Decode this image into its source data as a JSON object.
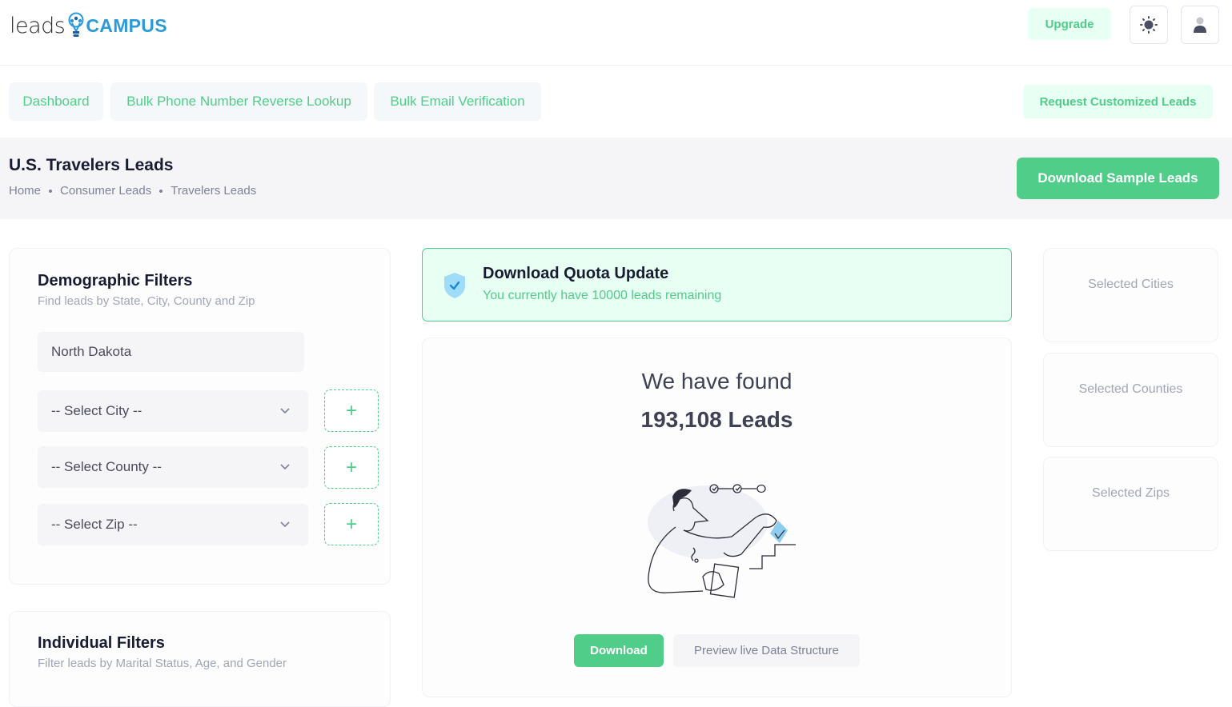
{
  "header": {
    "logo": {
      "part1": "leads",
      "part2": "CAMPUS"
    },
    "upgrade_label": "Upgrade",
    "theme_icon": "sun-icon",
    "user_icon": "user-icon"
  },
  "nav": {
    "items": [
      {
        "label": "Dashboard"
      },
      {
        "label": "Bulk Phone Number Reverse Lookup"
      },
      {
        "label": "Bulk Email Verification"
      }
    ],
    "request_label": "Request Customized Leads"
  },
  "toolbar": {
    "title": "U.S. Travelers Leads",
    "breadcrumb": [
      "Home",
      "Consumer Leads",
      "Travelers Leads"
    ],
    "sample_label": "Download Sample Leads"
  },
  "demographic": {
    "title": "Demographic Filters",
    "subtitle": "Find leads by State, City, County and Zip",
    "state_value": "North Dakota",
    "city_placeholder": "-- Select City --",
    "county_placeholder": "-- Select County --",
    "zip_placeholder": "-- Select Zip --",
    "add_label": "+"
  },
  "individual": {
    "title": "Individual Filters",
    "subtitle": "Filter leads by Marital Status, Age, and Gender"
  },
  "quota": {
    "title": "Download Quota Update",
    "message": "You currently have 10000 leads remaining",
    "remaining": 10000
  },
  "results": {
    "found_label": "We have found",
    "count_text": "193,108 Leads",
    "count": 193108,
    "download_label": "Download",
    "preview_label": "Preview live Data Structure"
  },
  "selected": {
    "cities_label": "Selected Cities",
    "counties_label": "Selected Counties",
    "zips_label": "Selected Zips"
  },
  "colors": {
    "accent": "#50cd89",
    "accent_light": "#e8fff3",
    "brand_blue": "#2d9ad8",
    "muted_text": "#a1a5b7"
  }
}
